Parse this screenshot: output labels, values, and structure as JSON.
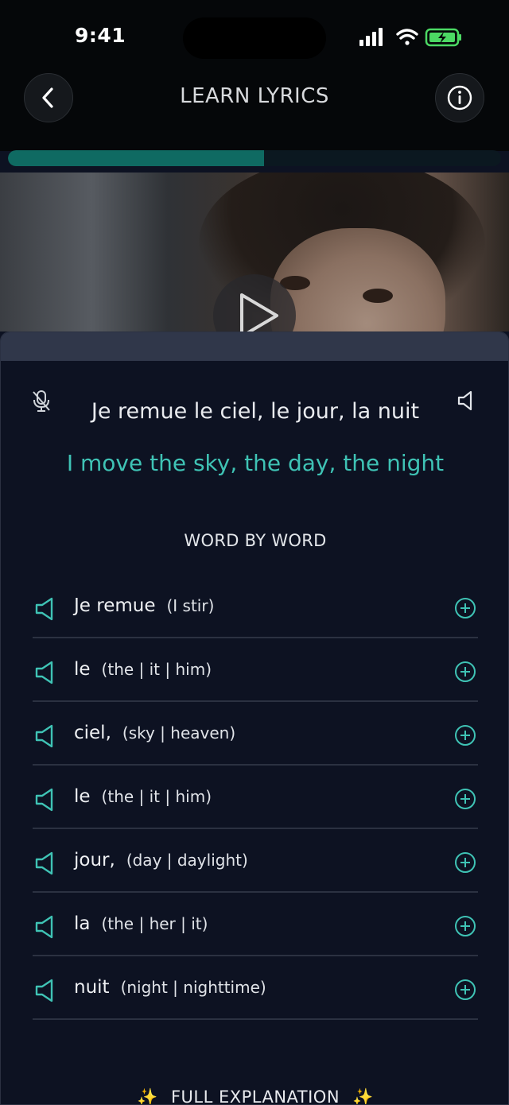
{
  "status_bar": {
    "time": "9:41"
  },
  "header": {
    "title": "LEARN LYRICS"
  },
  "progress": {
    "value": 0.52
  },
  "lyric": {
    "original": "Je remue le ciel, le jour, la nuit",
    "translation": "I move the sky, the day, the night"
  },
  "word_by_word": {
    "heading": "WORD BY WORD",
    "items": [
      {
        "word": "Je remue",
        "meaning": "(I stir)"
      },
      {
        "word": "le",
        "meaning": "(the | it | him)"
      },
      {
        "word": "ciel,",
        "meaning": "(sky | heaven)"
      },
      {
        "word": "le",
        "meaning": "(the | it | him)"
      },
      {
        "word": "jour,",
        "meaning": "(day | daylight)"
      },
      {
        "word": "la",
        "meaning": "(the | her | it)"
      },
      {
        "word": "nuit",
        "meaning": "(night | nighttime)"
      }
    ]
  },
  "footer": {
    "full_explanation": "FULL EXPLANATION",
    "sparkle": "✨"
  },
  "colors": {
    "accent": "#3fc3b5",
    "progress": "#0f6a62",
    "sheet_bg": "#0d1222"
  },
  "icons": [
    "back-icon",
    "info-icon",
    "play-icon",
    "mic-off-icon",
    "speaker-icon",
    "add-icon"
  ]
}
